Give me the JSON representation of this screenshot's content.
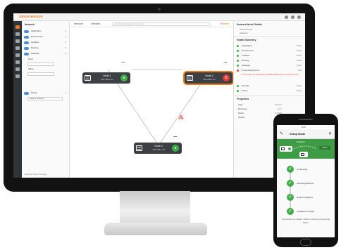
{
  "app": {
    "logo": "SENSORNODE",
    "search_placeholder": "Find Nearest Device Type ID #",
    "toolbar": {
      "left_label": "Network",
      "mid_label": "Interface",
      "right_link": "Refresh"
    }
  },
  "sidebar": {
    "title": "Network",
    "groups": [
      {
        "label": "Application"
      },
      {
        "label": "Environment"
      },
      {
        "label": "Location"
      },
      {
        "label": "Routing"
      },
      {
        "label": "Gateway"
      }
    ],
    "fields": [
      {
        "label": "Field"
      },
      {
        "label": "Value"
      }
    ],
    "filter": {
      "label": "Nodes",
      "value": "Asset 1, Asset 2"
    },
    "footer": "Network Node Topology"
  },
  "topology": {
    "nodes": [
      {
        "name": "Node 1",
        "ip": "192.168.1.41",
        "status": "ok",
        "status_symbol": "●"
      },
      {
        "name": "Node 2",
        "ip": "192.168.1.42",
        "status": "error",
        "status_symbol": "C"
      },
      {
        "name": "Node 3",
        "ip": "192.168.1.43",
        "status": "ok",
        "status_symbol": "●"
      }
    ],
    "link_colors": {
      "line": "#bbbbbb",
      "highlight": "#f07d1b",
      "warning": "#e53935"
    }
  },
  "details": {
    "title": "Network Node Details",
    "meta": [
      "Connected ID",
      "Adjacent"
    ],
    "health_title": "Health Summary",
    "checks": [
      {
        "label": "Application",
        "value": "Pass",
        "color": "#3fae49"
      },
      {
        "label": "Environment",
        "value": "Pass",
        "color": "#3fae49"
      },
      {
        "label": "Location",
        "value": "Pass",
        "color": "#3fae49"
      },
      {
        "label": "Routing",
        "value": "Pass",
        "color": "#3fae49"
      },
      {
        "label": "Gateway",
        "value": "Pass",
        "color": "#3fae49"
      },
      {
        "label": "Connectivity Errors",
        "value": "Fail",
        "color": "#e53935"
      }
    ],
    "alert_text": "1 of 3 nodes not responding. Check wireless link to node and retry.",
    "more_checks": [
      {
        "label": "Security",
        "value": "Pass",
        "color": "#3fae49"
      },
      {
        "label": "Power",
        "value": "Pass",
        "color": "#3fae49"
      }
    ],
    "props_title": "Properties",
    "props": [
      {
        "k": "Type",
        "v": "Sensor"
      },
      {
        "k": "Firmware",
        "v": "2.1.4"
      },
      {
        "k": "Serial",
        "v": "N-0042"
      },
      {
        "k": "Uptime",
        "v": "12 d"
      }
    ]
  },
  "phone": {
    "time": "9:41",
    "title": "Setup Node",
    "banner_labels": [
      "Gateway",
      "Node"
    ],
    "steps": [
      {
        "label": "Connecting"
      },
      {
        "label": "Scanning Devices"
      },
      {
        "label": "Node Configured"
      },
      {
        "label": "Installing Firmware"
      }
    ],
    "footer": "Connected to network. Node is online and reporting status."
  }
}
